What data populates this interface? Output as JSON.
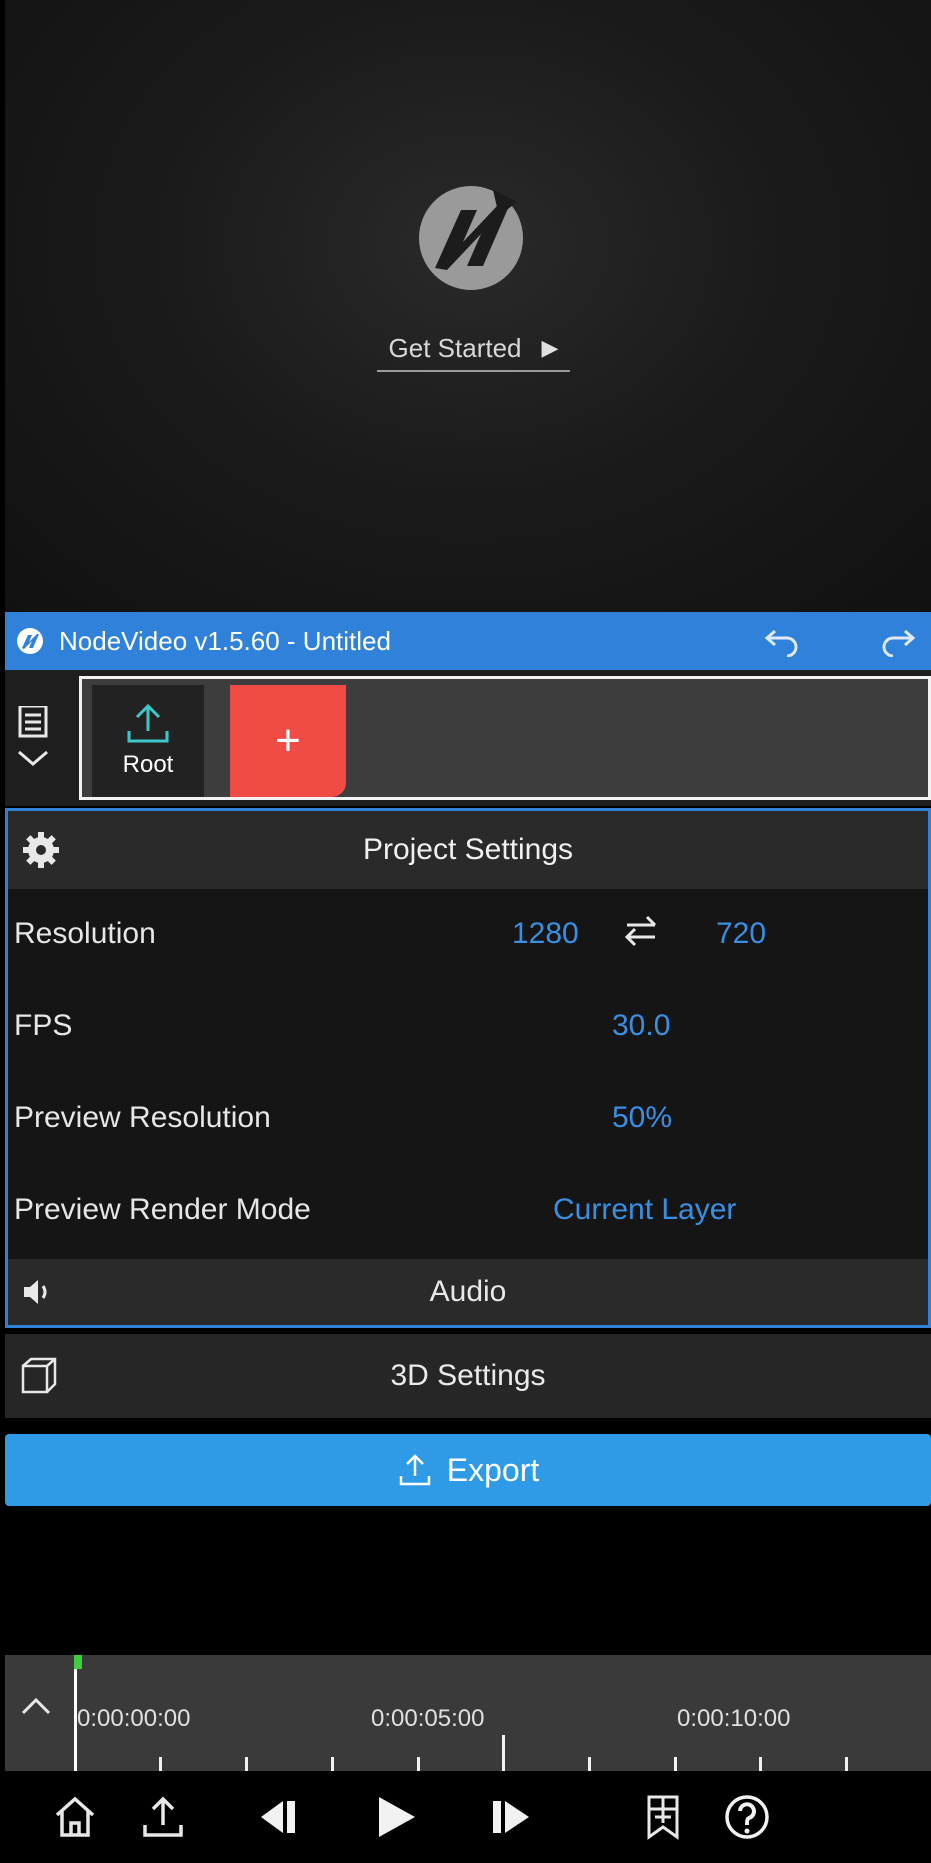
{
  "preview": {
    "get_started_label": "Get Started"
  },
  "titlebar": {
    "title": "NodeVideo v1.5.60 - Untitled"
  },
  "node_graph": {
    "root_label": "Root",
    "add_label": "+"
  },
  "project_settings": {
    "header": "Project Settings",
    "resolution": {
      "label": "Resolution",
      "width": "1280",
      "height": "720"
    },
    "fps": {
      "label": "FPS",
      "value": "30.0"
    },
    "preview_resolution": {
      "label": "Preview Resolution",
      "value": "50%"
    },
    "preview_render_mode": {
      "label": "Preview Render Mode",
      "value": "Current Layer"
    },
    "audio_label": "Audio"
  },
  "settings_3d": {
    "label": "3D Settings"
  },
  "export": {
    "label": "Export"
  },
  "timeline": {
    "timecodes": [
      "0:00:00:00",
      "0:00:05:00",
      "0:00:10:00"
    ]
  },
  "toolbar": {
    "icons": [
      "home-icon",
      "export-icon",
      "step-back-icon",
      "play-icon",
      "step-forward-icon",
      "bookmark-icon",
      "help-icon"
    ]
  },
  "colors": {
    "accent_blue": "#2f81d9",
    "value_blue": "#3b8fe3",
    "add_node_red": "#f04b45",
    "export_blue": "#2f9be6",
    "playhead_green": "#3fce3f"
  }
}
